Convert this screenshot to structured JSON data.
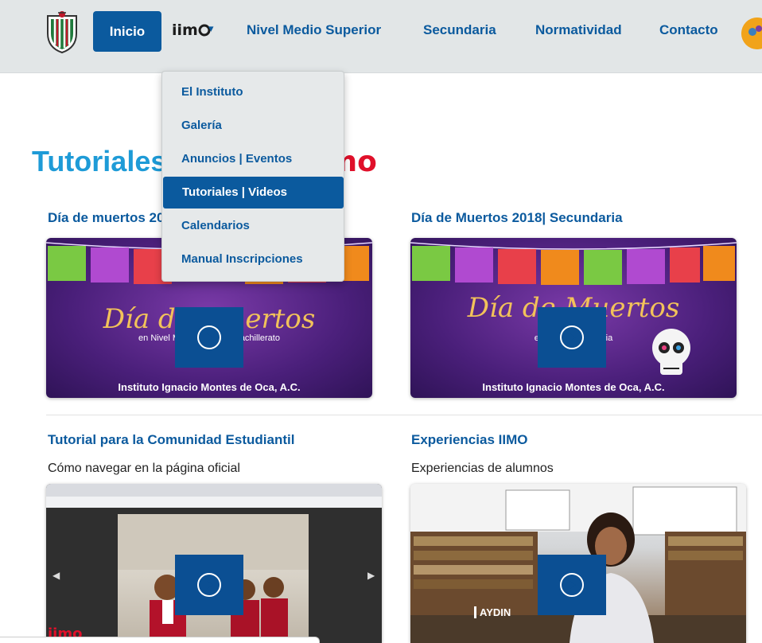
{
  "navbar": {
    "items": [
      {
        "label": "Inicio"
      },
      {
        "label": "Nivel Medio Superior"
      },
      {
        "label": "Secundaria"
      },
      {
        "label": "Normatividad"
      },
      {
        "label": "Contacto"
      }
    ],
    "brand_logo_text": "iimo",
    "dropdown_caret": "▾"
  },
  "dropdown": {
    "items": [
      {
        "label": "El Instituto"
      },
      {
        "label": "Galería"
      },
      {
        "label": "Anuncios | Eventos"
      },
      {
        "label": "Tutoriales | Videos",
        "active": true
      },
      {
        "label": "Calendarios"
      },
      {
        "label": "Manual Inscripciones"
      }
    ]
  },
  "page": {
    "title": "Tutoriales | Videos |",
    "title_brand": "iimo"
  },
  "cards": [
    {
      "title": "Día de muertos 2018| Nivel Medio Superior",
      "thumb_script": "Día de Muertos",
      "thumb_sub": "en Nivel Medio Superior Bachillerato",
      "thumb_footer": "Instituto Ignacio Montes de Oca, A.C."
    },
    {
      "title": "Día de Muertos 2018| Secundaria",
      "thumb_script": "Día de Muertos",
      "thumb_sub": "en Nivel Secundaria",
      "thumb_footer": "Instituto Ignacio Montes de Oca, A.C."
    },
    {
      "title": "Tutorial para la Comunidad Estudiantil",
      "subtitle": "Cómo navegar en la página oficial",
      "thumb_brand": "iimo"
    },
    {
      "title": "Experiencias IIMO",
      "subtitle": "Experiencias de alumnos",
      "thumb_caption": "AYDIN"
    }
  ],
  "colors": {
    "primary": "#0b5a9e",
    "title_blue": "#1e9bd7",
    "brand_red": "#e0102a",
    "navbar_bg": "#e2e6e7",
    "thumb_purple": "#5a2a8a"
  }
}
